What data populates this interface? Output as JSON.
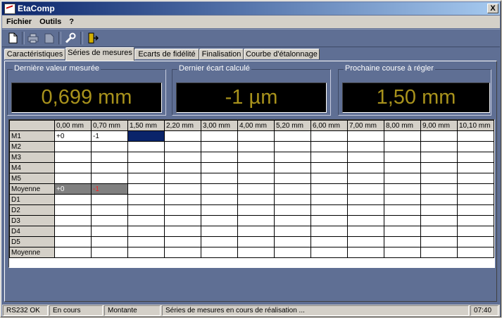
{
  "window": {
    "title": "EtaComp",
    "close_label": "X"
  },
  "menu": [
    {
      "label": "Fichier"
    },
    {
      "label": "Outils"
    },
    {
      "label": "?"
    }
  ],
  "toolbar": [
    "new-file-icon",
    "print-icon",
    "document-icon",
    "wrench-icon",
    "exit-icon"
  ],
  "tabs": [
    {
      "label": "Caractéristiques"
    },
    {
      "label": "Séries de mesures"
    },
    {
      "label": "Ecarts de fidélité"
    },
    {
      "label": "Finalisation"
    },
    {
      "label": "Courbe d'étalonnage"
    }
  ],
  "active_tab": "Séries de mesures",
  "displays": [
    {
      "label": "Dernière valeur mesurée",
      "value": "0,699 mm"
    },
    {
      "label": "Dernier écart calculé",
      "value": "-1 µm"
    },
    {
      "label": "Prochaine course à régler",
      "value": "1,50 mm"
    }
  ],
  "display_color": "#a8921c",
  "grid": {
    "columns": [
      "0,00 mm",
      "0,70 mm",
      "1,50 mm",
      "2,20 mm",
      "3,00 mm",
      "4,00 mm",
      "5,20 mm",
      "6,00 mm",
      "7,00 mm",
      "8,00 mm",
      "9,00 mm",
      "10,10 mm"
    ],
    "rows": [
      {
        "label": "M1",
        "cells": [
          "+0",
          "-1",
          "",
          "",
          "",
          "",
          "",
          "",
          "",
          "",
          "",
          ""
        ]
      },
      {
        "label": "M2",
        "cells": [
          "",
          "",
          "",
          "",
          "",
          "",
          "",
          "",
          "",
          "",
          "",
          ""
        ]
      },
      {
        "label": "M3",
        "cells": [
          "",
          "",
          "",
          "",
          "",
          "",
          "",
          "",
          "",
          "",
          "",
          ""
        ]
      },
      {
        "label": "M4",
        "cells": [
          "",
          "",
          "",
          "",
          "",
          "",
          "",
          "",
          "",
          "",
          "",
          ""
        ]
      },
      {
        "label": "M5",
        "cells": [
          "",
          "",
          "",
          "",
          "",
          "",
          "",
          "",
          "",
          "",
          "",
          ""
        ]
      },
      {
        "label": "Moyenne",
        "cells": [
          "+0",
          "-1",
          "",
          "",
          "",
          "",
          "",
          "",
          "",
          "",
          "",
          ""
        ]
      },
      {
        "label": "D1",
        "cells": [
          "",
          "",
          "",
          "",
          "",
          "",
          "",
          "",
          "",
          "",
          "",
          ""
        ]
      },
      {
        "label": "D2",
        "cells": [
          "",
          "",
          "",
          "",
          "",
          "",
          "",
          "",
          "",
          "",
          "",
          ""
        ]
      },
      {
        "label": "D3",
        "cells": [
          "",
          "",
          "",
          "",
          "",
          "",
          "",
          "",
          "",
          "",
          "",
          ""
        ]
      },
      {
        "label": "D4",
        "cells": [
          "",
          "",
          "",
          "",
          "",
          "",
          "",
          "",
          "",
          "",
          "",
          ""
        ]
      },
      {
        "label": "D5",
        "cells": [
          "",
          "",
          "",
          "",
          "",
          "",
          "",
          "",
          "",
          "",
          "",
          ""
        ]
      },
      {
        "label": "Moyenne",
        "cells": [
          "",
          "",
          "",
          "",
          "",
          "",
          "",
          "",
          "",
          "",
          "",
          ""
        ]
      }
    ],
    "selected_cell": {
      "row": "M1",
      "column": "1,50 mm"
    }
  },
  "status": [
    "RS232 OK",
    "En cours",
    "Montante",
    "Séries de mesures en cours de réalisation ...",
    "07:40"
  ]
}
